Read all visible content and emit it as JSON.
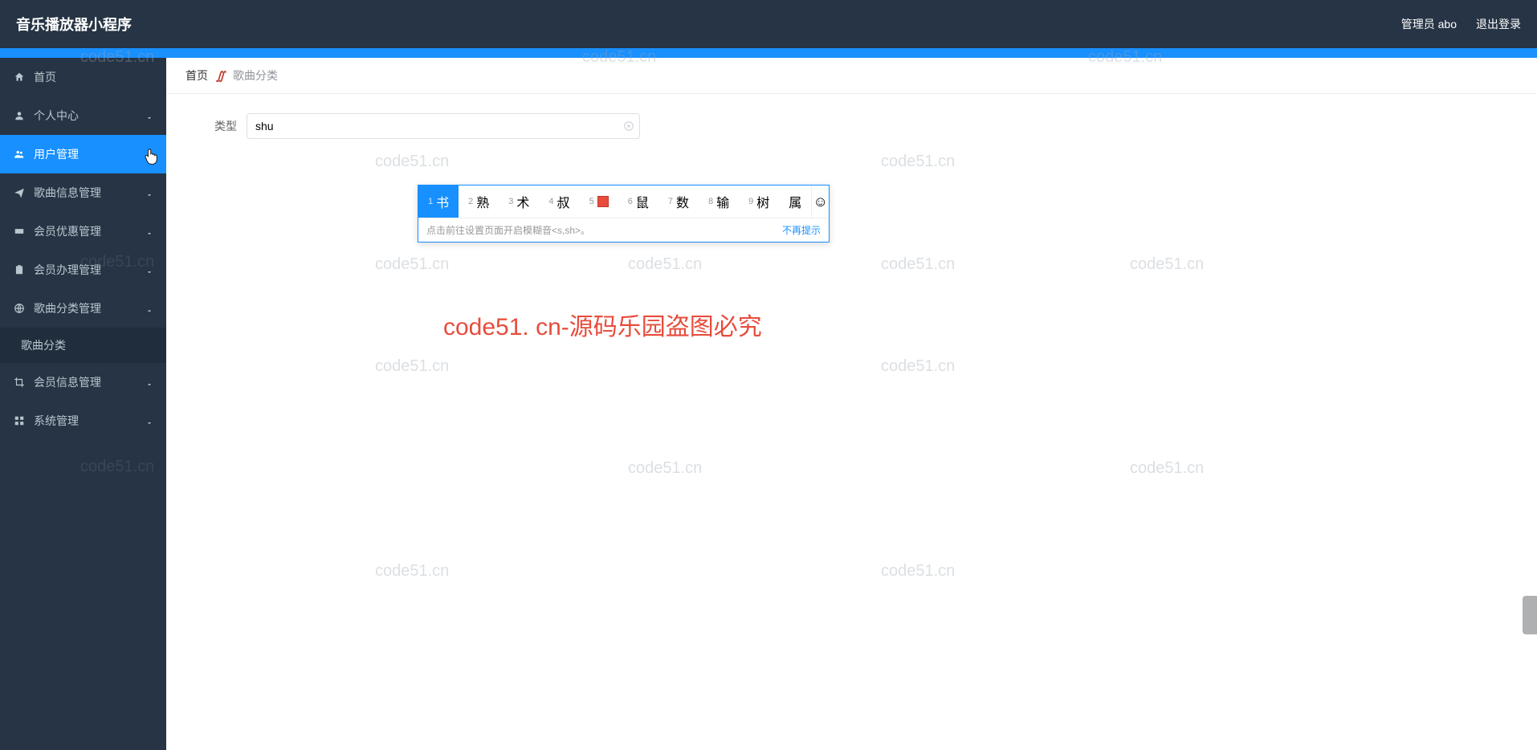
{
  "header": {
    "title": "音乐播放器小程序",
    "admin": "管理员 abo",
    "logout": "退出登录"
  },
  "sidebar": {
    "items": [
      {
        "label": "首页",
        "icon": "home"
      },
      {
        "label": "个人中心",
        "icon": "user",
        "arrow": "down"
      },
      {
        "label": "用户管理",
        "icon": "users",
        "arrow": "down",
        "active": true
      },
      {
        "label": "歌曲信息管理",
        "icon": "send",
        "arrow": "down"
      },
      {
        "label": "会员优惠管理",
        "icon": "ticket",
        "arrow": "down"
      },
      {
        "label": "会员办理管理",
        "icon": "clipboard",
        "arrow": "down"
      },
      {
        "label": "歌曲分类管理",
        "icon": "globe",
        "arrow": "up",
        "expanded": true
      },
      {
        "label": "会员信息管理",
        "icon": "crop",
        "arrow": "down"
      },
      {
        "label": "系统管理",
        "icon": "grid",
        "arrow": "down"
      }
    ],
    "sub_song_category": "歌曲分类"
  },
  "breadcrumb": {
    "home": "首页",
    "current": "歌曲分类"
  },
  "form": {
    "type_label": "类型",
    "type_value": "shu"
  },
  "ime": {
    "candidates": [
      {
        "num": "1",
        "char": "书"
      },
      {
        "num": "2",
        "char": "熟"
      },
      {
        "num": "3",
        "char": "术"
      },
      {
        "num": "4",
        "char": "叔"
      },
      {
        "num": "5",
        "char": "",
        "red": true
      },
      {
        "num": "6",
        "char": "鼠"
      },
      {
        "num": "7",
        "char": "数"
      },
      {
        "num": "8",
        "char": "输"
      },
      {
        "num": "9",
        "char": "树"
      }
    ],
    "last_char": "属",
    "hint_text": "点击前往设置页面开启模糊音<s,sh>。",
    "hint_dismiss": "不再提示"
  },
  "watermarks": {
    "text": "code51.cn",
    "big": "code51. cn-源码乐园盗图必究"
  }
}
